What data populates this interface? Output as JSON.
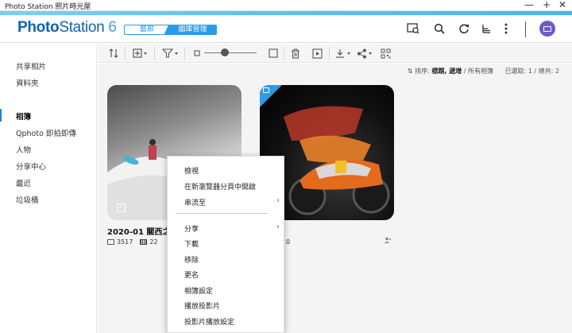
{
  "window": {
    "title": "Photo Station 照片時光屋",
    "controls": [
      "—",
      "+",
      "✕"
    ]
  },
  "header": {
    "logo_photo": "Photo",
    "logo_station": "Station",
    "logo_version": "6",
    "view_tabs": [
      "藝廊",
      "圖庫管理"
    ],
    "active_view": "圖庫管理",
    "icons": [
      "search-photo-icon",
      "search-icon",
      "refresh-icon",
      "stack-icon",
      "more-vertical-icon",
      "user-avatar-icon"
    ]
  },
  "sidebar": {
    "items": [
      {
        "label": "共享相片"
      },
      {
        "label": "資料夾"
      },
      {
        "label": "相簿",
        "active": true
      },
      {
        "label": "Qphoto 即拍即傳"
      },
      {
        "label": "人物"
      },
      {
        "label": "分享中心"
      },
      {
        "label": "最近"
      },
      {
        "label": "垃圾桶"
      }
    ]
  },
  "toolbar": {
    "icons": [
      "sort-icon",
      "add-icon",
      "filter-icon",
      "small-thumb-icon",
      "large-thumb-icon",
      "delete-icon",
      "slideshow-icon",
      "download-icon",
      "share-icon",
      "qr-icon"
    ]
  },
  "sortbar": {
    "prefix": "排序: ",
    "sort_value": "標題, 遞增",
    "scope": " / 所有相簿",
    "selection": "已選取: 1 / 總共: 2"
  },
  "albums": [
    {
      "title": "2020-01 關西之旅",
      "title_visible": "2020-01 關西之旅",
      "photos": "3517",
      "videos": "22",
      "selected": true
    },
    {
      "title": "",
      "photos": "",
      "videos": "0",
      "shared": true
    }
  ],
  "context_menu": {
    "items": [
      {
        "label": "檢視"
      },
      {
        "label": "在新瀏覽器分頁中開啟"
      },
      {
        "label": "串流至",
        "submenu": true
      },
      {
        "label": "分享",
        "submenu": true
      },
      {
        "label": "下載"
      },
      {
        "label": "移除"
      },
      {
        "label": "更名"
      },
      {
        "label": "相簿設定"
      },
      {
        "label": "播放投影片"
      },
      {
        "label": "投影片播放設定"
      }
    ]
  },
  "colors": {
    "accent": "#2b9be8",
    "brand": "#0e63b6",
    "avatar": "#6a5cc9"
  }
}
